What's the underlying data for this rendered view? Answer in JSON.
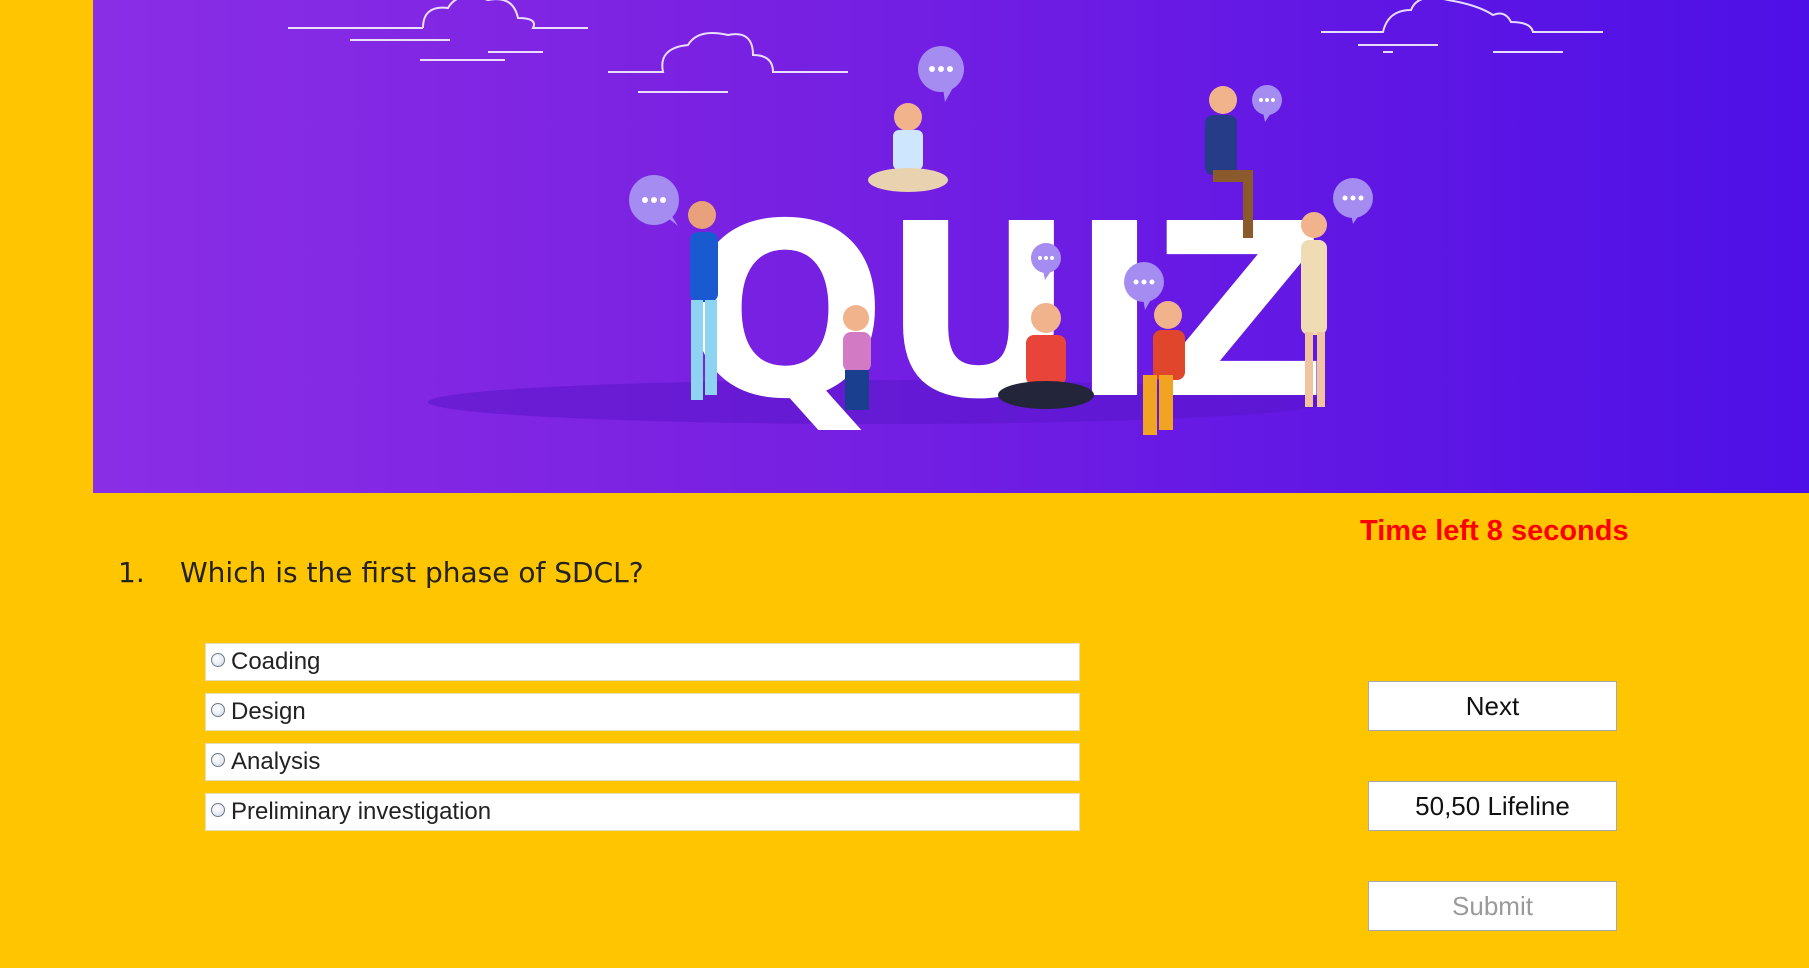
{
  "banner": {
    "title": "QUIZ",
    "colors": {
      "gradient_start": "#8a2ee6",
      "gradient_end": "#4d10e6"
    }
  },
  "timer": {
    "text": "Time left 8 seconds",
    "color": "#ff0000"
  },
  "question": {
    "number": "1.",
    "text": "Which is the first phase of SDCL?"
  },
  "options": [
    {
      "label": "Coading",
      "selected": false
    },
    {
      "label": "Design",
      "selected": false
    },
    {
      "label": "Analysis",
      "selected": false
    },
    {
      "label": "Preliminary investigation",
      "selected": false
    }
  ],
  "buttons": {
    "next": "Next",
    "lifeline": "50,50 Lifeline",
    "submit": "Submit",
    "submit_disabled": true
  },
  "page_background": "#FFC600"
}
